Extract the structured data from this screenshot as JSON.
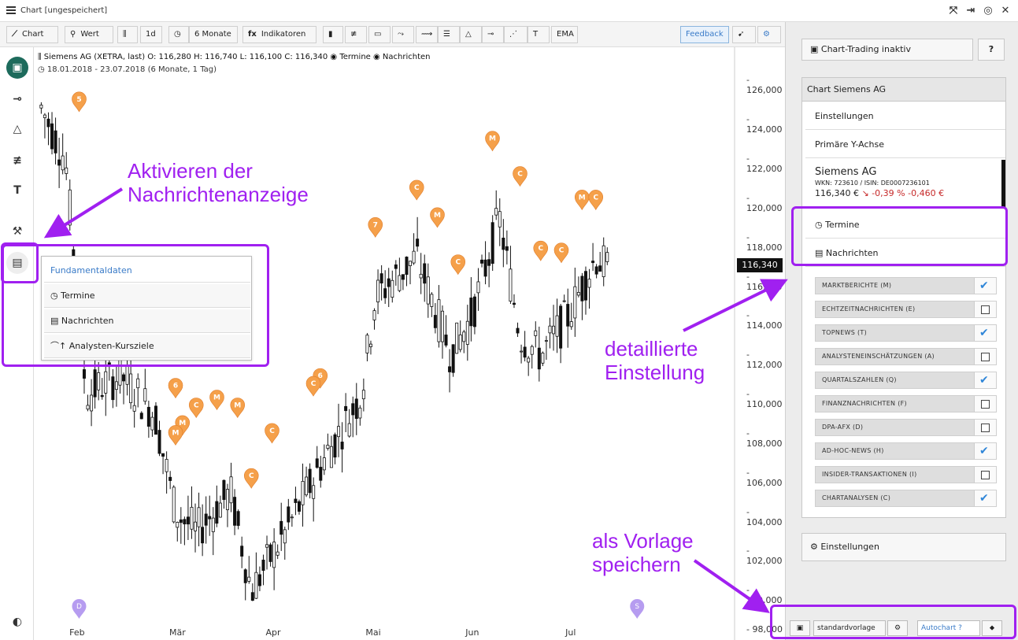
{
  "window": {
    "title": "Chart [ungespeichert]"
  },
  "toolbar": {
    "chart": "Chart",
    "wert": "Wert",
    "interval": "1d",
    "period": "6 Monate",
    "indicators": "Indikatoren",
    "ema": "EMA",
    "feedback": "Feedback"
  },
  "chart_header": {
    "line1": "Siemens AG (XETRA, last)  O: 116,280  H: 116,740  L: 116,100  C: 116,340",
    "termine": "Termine",
    "nachrichten": "Nachrichten",
    "range": "18.01.2018 - 23.07.2018   (6 Monate, 1 Tag)",
    "last_price": "116,340"
  },
  "chart_data": {
    "type": "candlestick",
    "y_ticks": [
      "126,000",
      "124,000",
      "122,000",
      "120,000",
      "118,000",
      "116,000",
      "114,000",
      "112,000",
      "110,000",
      "108,000",
      "106,000",
      "104,000",
      "102,000",
      "100,000",
      "98,000"
    ],
    "x_ticks": [
      "Feb",
      "Mär",
      "Apr",
      "Mai",
      "Jun",
      "Jul"
    ],
    "ylim": [
      98,
      126.5
    ],
    "markers": [
      {
        "label": "5",
        "x": 0.06,
        "y": 124.9
      },
      {
        "label": "M",
        "x": 0.66,
        "y": 122.9
      },
      {
        "label": "C",
        "x": 0.7,
        "y": 121.1
      },
      {
        "label": "C",
        "x": 0.55,
        "y": 120.4
      },
      {
        "label": "M",
        "x": 0.79,
        "y": 119.9
      },
      {
        "label": "C",
        "x": 0.81,
        "y": 119.9
      },
      {
        "label": "M",
        "x": 0.58,
        "y": 119
      },
      {
        "label": "7",
        "x": 0.49,
        "y": 118.5
      },
      {
        "label": "C",
        "x": 0.73,
        "y": 117.3
      },
      {
        "label": "C",
        "x": 0.76,
        "y": 117.2
      },
      {
        "label": "C",
        "x": 0.61,
        "y": 116.6
      },
      {
        "label": "6",
        "x": 0.41,
        "y": 110.8
      },
      {
        "label": "C",
        "x": 0.4,
        "y": 110.4
      },
      {
        "label": "6",
        "x": 0.2,
        "y": 110.3
      },
      {
        "label": "C",
        "x": 0.23,
        "y": 109.3
      },
      {
        "label": "M",
        "x": 0.26,
        "y": 109.7
      },
      {
        "label": "M",
        "x": 0.29,
        "y": 109.3
      },
      {
        "label": "M",
        "x": 0.21,
        "y": 108.4
      },
      {
        "label": "M",
        "x": 0.2,
        "y": 107.9
      },
      {
        "label": "C",
        "x": 0.34,
        "y": 108
      },
      {
        "label": "C",
        "x": 0.31,
        "y": 105.7
      }
    ],
    "event_markers": [
      {
        "label": "D",
        "x": 0.06
      },
      {
        "label": "S",
        "x": 0.87
      }
    ]
  },
  "popup": {
    "items": [
      "Fundamentaldaten",
      "Termine",
      "Nachrichten",
      "Analysten-Kursziele"
    ]
  },
  "right_panel": {
    "trading": "Chart-Trading inaktiv",
    "help": "?",
    "card_title": "Chart Siemens AG",
    "einstellungen": "Einstellungen",
    "primary_axis": "Primäre Y-Achse",
    "stock_name": "Siemens AG",
    "wkn": "WKN: 723610 / ISIN: DE0007236101",
    "price": "116,340 €",
    "change_pct": "-0,39 %",
    "change_abs": "-0,460 €",
    "termine": "Termine",
    "nachrichten": "Nachrichten",
    "news": [
      {
        "label": "MARKTBERICHTE (M)",
        "checked": true
      },
      {
        "label": "ECHTZEITNACHRICHTEN (E)",
        "checked": false
      },
      {
        "label": "TOPNEWS (T)",
        "checked": true
      },
      {
        "label": "ANALYSTENEINSCHÄTZUNGEN (A)",
        "checked": false
      },
      {
        "label": "QUARTALSZAHLEN (Q)",
        "checked": true
      },
      {
        "label": "FINANZNACHRICHTEN (F)",
        "checked": false
      },
      {
        "label": "DPA-AFX (D)",
        "checked": false
      },
      {
        "label": "AD-HOC-NEWS (H)",
        "checked": true
      },
      {
        "label": "INSIDER-TRANSAKTIONEN (I)",
        "checked": false
      },
      {
        "label": "CHARTANALYSEN (C)",
        "checked": true
      }
    ],
    "settings_bottom": "Einstellungen"
  },
  "bottom_bar": {
    "template": "standardvorlage",
    "autochart": "Autochart",
    "help": "?"
  },
  "annotations": {
    "a1_line1": "Aktivieren der",
    "a1_line2": "Nachrichtenanzeige",
    "a2_line1": "detaillierte",
    "a2_line2": "Einstellung",
    "a3_line1": "als Vorlage",
    "a3_line2": "speichern"
  },
  "colors": {
    "marker": "#f5a04a",
    "accent": "#a020f0",
    "check": "#2f86d8",
    "active_green": "#1d6b5c"
  }
}
